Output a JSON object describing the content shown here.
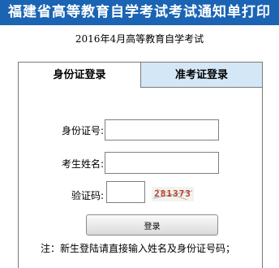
{
  "header": {
    "title": "福建省高等教育自学考试考试通知单打印",
    "bg_color": "#1b64b3"
  },
  "subtitle": "2016年4月高等教育自学考试",
  "tabs": [
    {
      "label": "身份证登录",
      "active": true
    },
    {
      "label": "准考证登录",
      "active": false
    }
  ],
  "form": {
    "id_label": "身份证号:",
    "id_value": "",
    "name_label": "考生姓名:",
    "name_value": "",
    "captcha_label": "验证码:",
    "captcha_value": "",
    "captcha_text": "281373",
    "login_label": "登录"
  },
  "note": "注：新生登陆请直接输入姓名及身份证号码；"
}
